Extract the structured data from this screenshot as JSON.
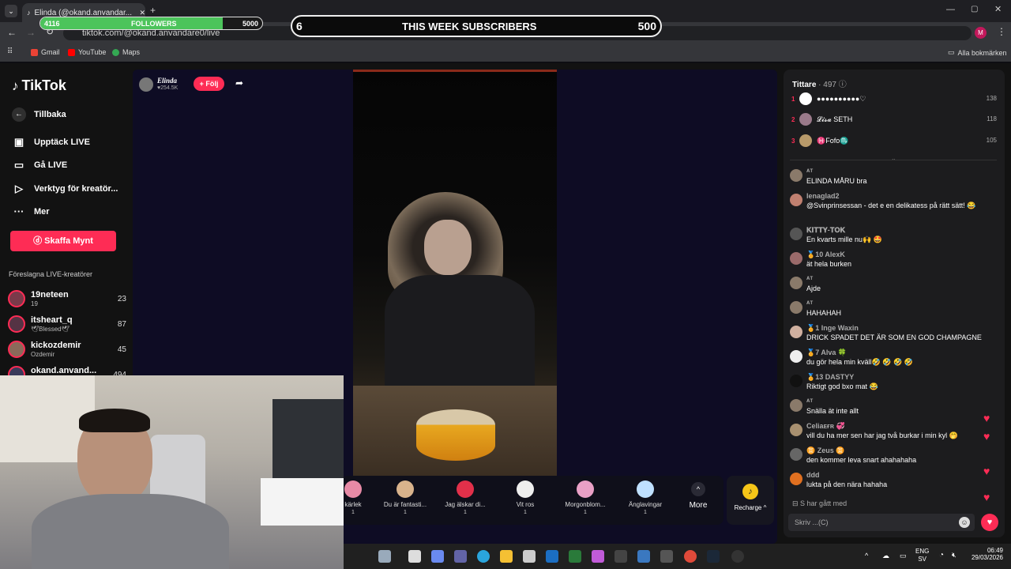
{
  "browser": {
    "tab_title": "Elinda (@okand.anvandar...",
    "url": "tiktok.com/@okand.anvandare0/live",
    "bookmarks": [
      "Gmail",
      "YouTube",
      "Maps"
    ],
    "all_bookmarks": "Alla bokmärken",
    "profile_initial": "M"
  },
  "overlay": {
    "followers_current": "4116",
    "followers_label": "FOLLOWERS",
    "followers_goal": "5000",
    "followers_progress": 0.8232,
    "subs_current": "6",
    "subs_label": "THIS WEEK SUBSCRIBERS",
    "subs_goal": "500"
  },
  "sidebar": {
    "logo": "TikTok",
    "back": "Tillbaka",
    "items": [
      "Upptäck LIVE",
      "Gå LIVE",
      "Verktyg för kreatör...",
      "Mer"
    ],
    "coins_button": "Skaffa Mynt",
    "suggested_title": "Föreslagna LIVE-kreatörer",
    "creators": [
      {
        "name": "19neteen",
        "sub": "19",
        "count": "23"
      },
      {
        "name": "itsheart_q",
        "sub": "🕊Blessed🕊",
        "count": "87"
      },
      {
        "name": "kickozdemir",
        "sub": "Ozdemir",
        "count": "45"
      },
      {
        "name": "okand.anvand...",
        "sub": "",
        "count": "494"
      }
    ]
  },
  "stream": {
    "host_name": "Elinda",
    "host_likes": "♥254.5K",
    "follow_label": "+ Följ"
  },
  "gifts": [
    {
      "name": "kärlek",
      "price": "1"
    },
    {
      "name": "Du är fantasti...",
      "price": "1"
    },
    {
      "name": "Jag älskar di...",
      "price": "1"
    },
    {
      "name": "Vit ros",
      "price": "1"
    },
    {
      "name": "Morgonblom...",
      "price": "1"
    },
    {
      "name": "Änglavingar",
      "price": "1"
    }
  ],
  "gift_more": "More",
  "recharge": "Recharge ^",
  "chat": {
    "viewers_label": "Tittare",
    "viewers_count": "· 497",
    "top": [
      {
        "rank": "1",
        "name": "●●●●●●●●●●♡",
        "score": "138"
      },
      {
        "rank": "2",
        "name": "𝓛𝓲𝓼𝓪 SETH",
        "score": "118"
      },
      {
        "rank": "3",
        "name": "♓Fofo♏",
        "score": "105"
      }
    ],
    "messages": [
      {
        "user": "ᴬᵀ",
        "text": "ELINDA MÅRU bra"
      },
      {
        "user": "lenaglad2",
        "text": "@Svinprinsessan - det e en delikatess på rätt sätt! 😂"
      },
      {
        "user": "𝐊𝐈𝐓𝐓𝐘-𝐓𝐎𝐊",
        "text": "En kvarts mille nu🙌 🤩"
      },
      {
        "user": "🏅10  AlexK",
        "text": "ät hela burken"
      },
      {
        "user": "ᴬᵀ",
        "text": "Ajde"
      },
      {
        "user": "ᴬᵀ",
        "text": "HAHAHAH"
      },
      {
        "user": "🏅1  Inge Waxin",
        "text": "DRICK SPADET DET ÄR SOM EN GOD CHAMPAGNE"
      },
      {
        "user": "🏅7  Alva 🍀",
        "text": "du gör hela min kväll🤣 🤣 🤣 🤣"
      },
      {
        "user": "🏅13  DASTYY",
        "text": "Riktigt god bxo mat 😂"
      },
      {
        "user": "ᴬᵀ",
        "text": "Snälla ät inte allt"
      },
      {
        "user": "Celiaᴇғʀ 💞",
        "text": "vill du ha mer sen har jag två burkar i min kyl 🤭"
      },
      {
        "user": "♊ Zeus ♊",
        "text": "den kommer leva snart ahahahaha"
      },
      {
        "user": "ddd",
        "text": "lukta på den nära hahaha"
      }
    ],
    "joined": "S  har gått med",
    "input_placeholder": "Skriv ...(C)"
  },
  "taskbar": {
    "lang": "ENG",
    "lang2": "SV",
    "time": "06:49",
    "date": "29/03/2026"
  }
}
